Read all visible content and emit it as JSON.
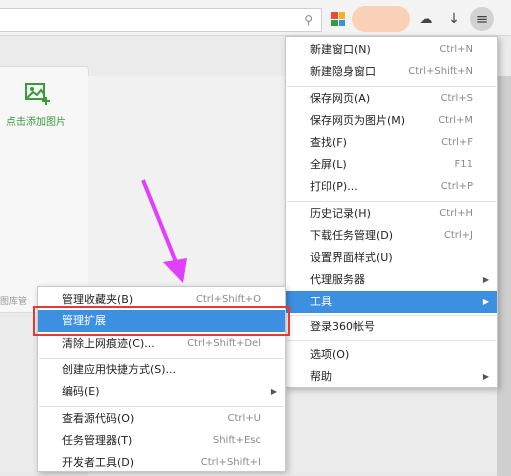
{
  "toolbar": {
    "search_icon": "search-icon",
    "apps_colors": [
      "#e94b3c",
      "#f6b21b",
      "#2ea043",
      "#3d8fe0"
    ],
    "avatar_color": "#fbd0b8"
  },
  "card": {
    "add_image_label": "点击添加图片",
    "accent": "#3a9a3a"
  },
  "left_partial_label": "图库管",
  "main_menu": {
    "items": [
      {
        "label": "新建窗口(N)",
        "shortcut": "Ctrl+N"
      },
      {
        "label": "新建隐身窗口",
        "shortcut": "Ctrl+Shift+N"
      },
      {
        "label": "保存网页(A)",
        "shortcut": "Ctrl+S"
      },
      {
        "label": "保存网页为图片(M)",
        "shortcut": "Ctrl+M"
      },
      {
        "label": "查找(F)",
        "shortcut": "Ctrl+F"
      },
      {
        "label": "全屏(L)",
        "shortcut": "F11"
      },
      {
        "label": "打印(P)...",
        "shortcut": "Ctrl+P"
      },
      {
        "label": "历史记录(H)",
        "shortcut": "Ctrl+H"
      },
      {
        "label": "下载任务管理(D)",
        "shortcut": "Ctrl+J"
      },
      {
        "label": "设置界面样式(U)",
        "shortcut": ""
      },
      {
        "label": "代理服务器",
        "shortcut": ""
      },
      {
        "label": "工具",
        "shortcut": ""
      },
      {
        "label": "登录360帐号",
        "shortcut": ""
      },
      {
        "label": "选项(O)",
        "shortcut": ""
      },
      {
        "label": "帮助",
        "shortcut": ""
      }
    ]
  },
  "tools_submenu": {
    "items": [
      {
        "label": "管理收藏夹(B)",
        "shortcut": "Ctrl+Shift+O"
      },
      {
        "label": "管理扩展",
        "shortcut": ""
      },
      {
        "label": "清除上网痕迹(C)...",
        "shortcut": "Ctrl+Shift+Del"
      },
      {
        "label": "创建应用快捷方式(S)...",
        "shortcut": ""
      },
      {
        "label": "编码(E)",
        "shortcut": ""
      },
      {
        "label": "查看源代码(O)",
        "shortcut": "Ctrl+U"
      },
      {
        "label": "任务管理器(T)",
        "shortcut": "Shift+Esc"
      },
      {
        "label": "开发者工具(D)",
        "shortcut": "Ctrl+Shift+I"
      }
    ]
  },
  "highlight_color": "#3d8fe0",
  "annotation_color": "#e53935",
  "arrow_color": "#e040fb"
}
